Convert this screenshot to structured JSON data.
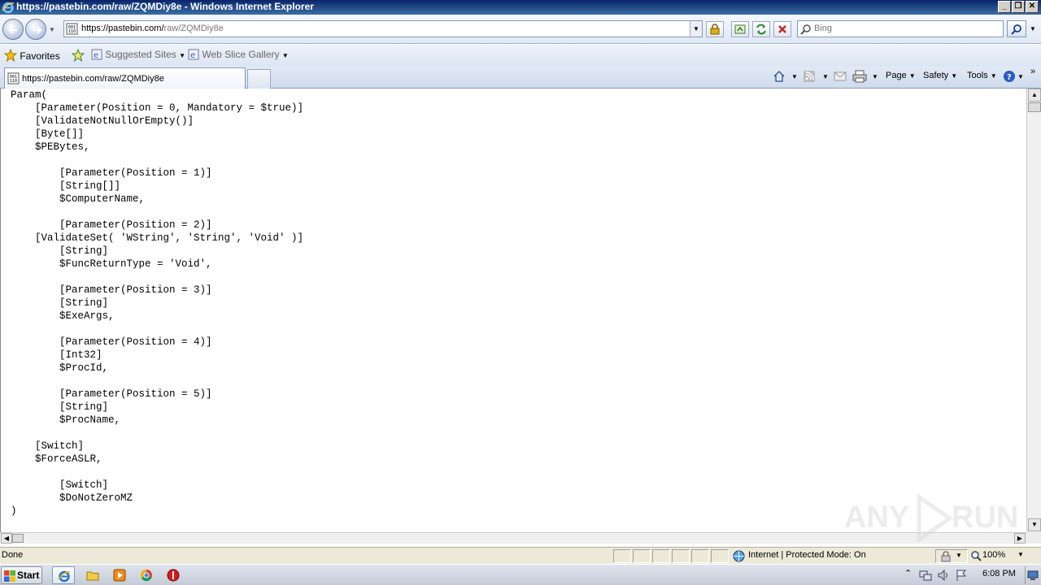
{
  "window": {
    "title": "https://pastebin.com/raw/ZQMDiy8e - Windows Internet Explorer",
    "minimize_label": "_",
    "restore_label": "❐",
    "close_label": "✕"
  },
  "navbar": {
    "url_main": "https://pastebin.com/",
    "url_path": "raw/ZQMDiy8e",
    "search_placeholder": "Bing"
  },
  "favorites": {
    "favorites_label": "Favorites",
    "suggested_sites_label": "Suggested Sites",
    "web_slice_label": "Web Slice Gallery"
  },
  "tab": {
    "label": "https://pastebin.com/raw/ZQMDiy8e"
  },
  "commandbar": {
    "page_label": "Page",
    "safety_label": "Safety",
    "tools_label": "Tools"
  },
  "content": {
    "code_lines": [
      "Param(",
      "    [Parameter(Position = 0, Mandatory = $true)]",
      "    [ValidateNotNullOrEmpty()]",
      "    [Byte[]]",
      "    $PEBytes,",
      "",
      "        [Parameter(Position = 1)]",
      "        [String[]]",
      "        $ComputerName,",
      "",
      "        [Parameter(Position = 2)]",
      "    [ValidateSet( 'WString', 'String', 'Void' )]",
      "        [String]",
      "        $FuncReturnType = 'Void',",
      "",
      "        [Parameter(Position = 3)]",
      "        [String]",
      "        $ExeArgs,",
      "",
      "        [Parameter(Position = 4)]",
      "        [Int32]",
      "        $ProcId,",
      "",
      "        [Parameter(Position = 5)]",
      "        [String]",
      "        $ProcName,",
      "",
      "    [Switch]",
      "    $ForceASLR,",
      "",
      "        [Switch]",
      "        $DoNotZeroMZ",
      ")"
    ]
  },
  "statusbar": {
    "status_text": "Done",
    "zone_text": "Internet | Protected Mode: On",
    "zoom_text": "100%"
  },
  "taskbar": {
    "start_label": "Start",
    "clock": "6:08 PM"
  },
  "watermark": {
    "text_left": "ANY",
    "text_right": "RUN"
  }
}
